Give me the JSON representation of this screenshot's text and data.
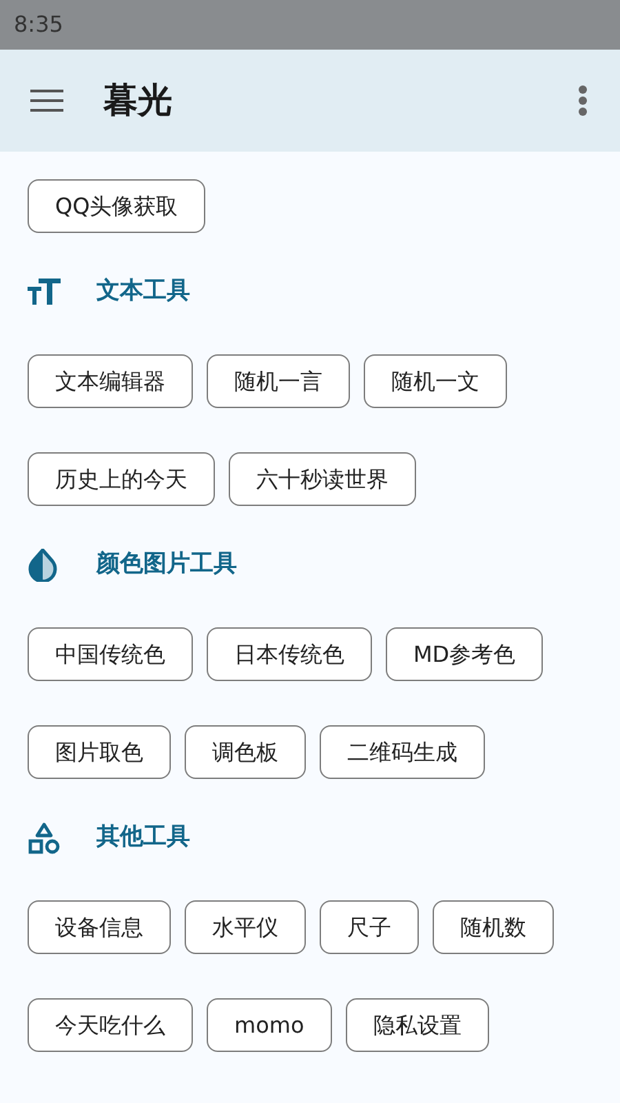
{
  "status_bar": {
    "time": "8:35"
  },
  "app_bar": {
    "title": "暮光"
  },
  "sections": [
    {
      "rows": [
        [
          "QQ头像获取"
        ]
      ]
    },
    {
      "heading": "文本工具",
      "rows": [
        [
          "文本编辑器",
          "随机一言",
          "随机一文"
        ],
        [
          "历史上的今天",
          "六十秒读世界"
        ]
      ]
    },
    {
      "heading": "颜色图片工具",
      "rows": [
        [
          "中国传统色",
          "日本传统色",
          "MD参考色"
        ],
        [
          "图片取色",
          "调色板",
          "二维码生成"
        ]
      ]
    },
    {
      "heading": "其他工具",
      "rows": [
        [
          "设备信息",
          "水平仪",
          "尺子",
          "随机数"
        ],
        [
          "今天吃什么",
          "momo",
          "隐私设置"
        ]
      ]
    }
  ]
}
